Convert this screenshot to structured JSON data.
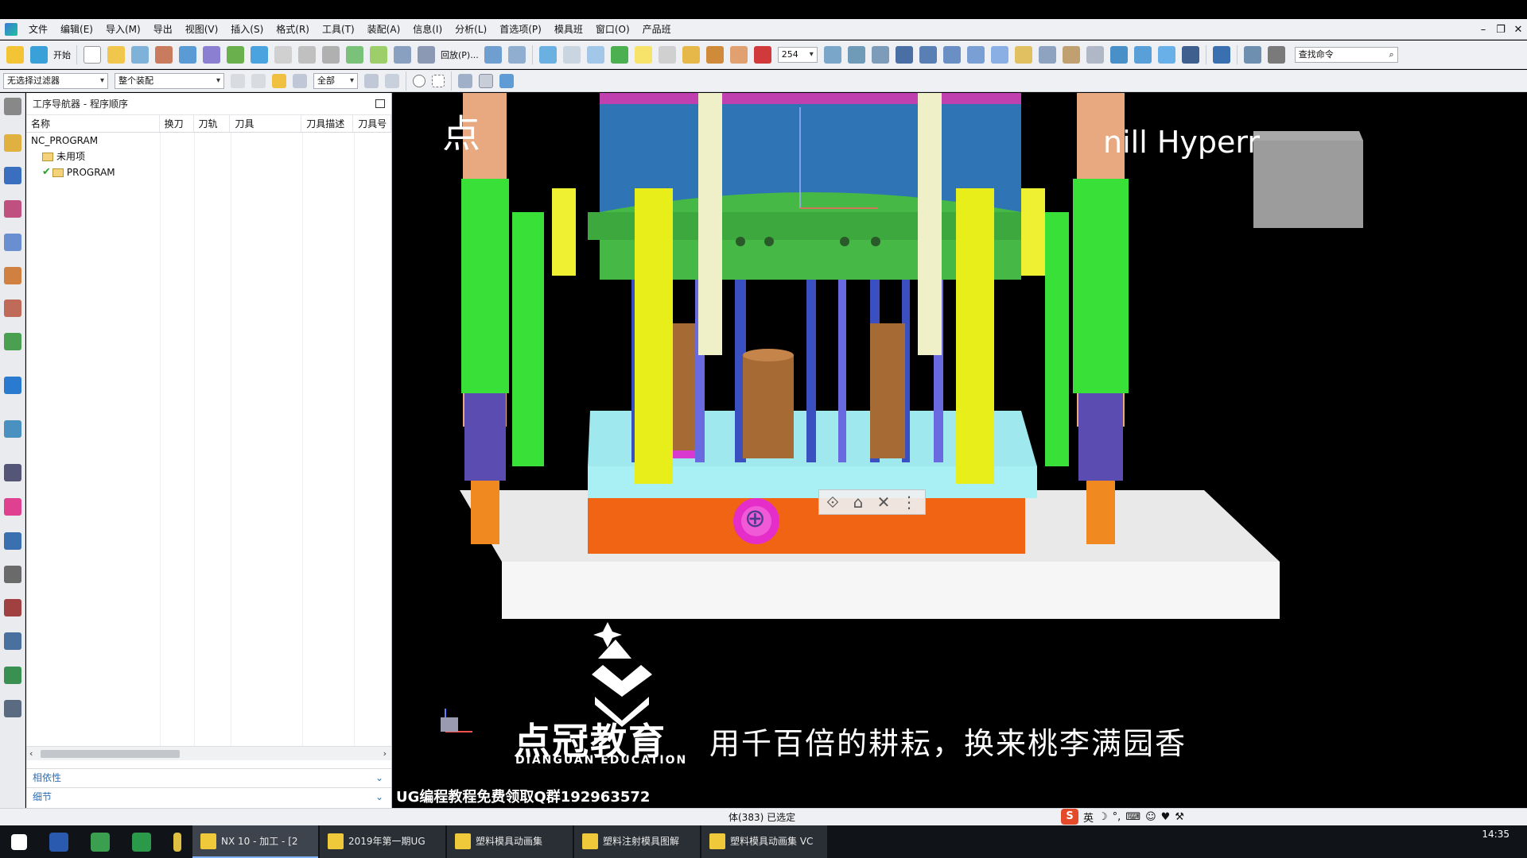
{
  "menubar": {
    "items": [
      "文件",
      "编辑(E)",
      "导入(M)",
      "导出",
      "视图(V)",
      "插入(S)",
      "格式(R)",
      "工具(T)",
      "装配(A)",
      "信息(I)",
      "分析(L)",
      "首选项(P)",
      "模具班",
      "窗口(O)",
      "产品班"
    ]
  },
  "toolbar": {
    "start_label": "开始",
    "undo_label": "回放(P)...",
    "render_value": "254",
    "search_placeholder": "查找命令",
    "selection_filter": "无选择过滤器",
    "assembly_scope": "整个装配",
    "scope_all": "全部"
  },
  "navigator": {
    "title": "工序导航器 - 程序顺序",
    "columns": [
      "名称",
      "换刀",
      "刀轨",
      "刀具",
      "刀具描述",
      "刀具号"
    ],
    "rows": [
      {
        "label": "NC_PROGRAM",
        "level": 0
      },
      {
        "label": "未用项",
        "level": 1
      },
      {
        "label": "PROGRAM",
        "level": 1
      }
    ],
    "panels": [
      "相依性",
      "细节"
    ]
  },
  "viewport": {
    "overlay_title_left": "点",
    "overlay_title": "nill Hyperr",
    "brand_name": "点冠教育",
    "brand_sub": "DIANGUAN EDUCATION",
    "slogan": "用千百倍的耕耘，换来桃李满园香",
    "qq_text": "UG编程教程免费领取Q群192963572"
  },
  "statusbar": {
    "status": "体(383) 已选定",
    "ime": "英"
  },
  "taskbar": {
    "buttons": [
      "NX 10 - 加工 - [2",
      "2019年第一期UG",
      "塑料模具动画集",
      "塑料注射模具图解",
      "塑料模具动画集 VC"
    ],
    "time": "14:35"
  }
}
